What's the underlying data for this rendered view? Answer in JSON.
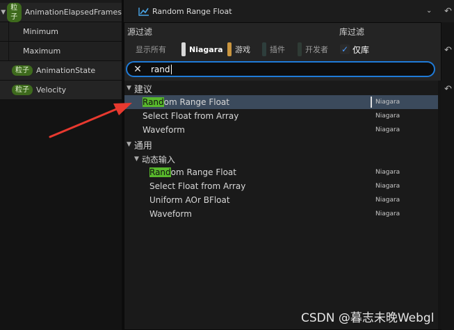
{
  "params": {
    "rows": [
      {
        "badge": "粒子",
        "name": "AnimationElapsedFrames",
        "expanded": true
      },
      {
        "name": "Minimum"
      },
      {
        "name": "Maximum"
      },
      {
        "badge": "粒子",
        "name": "AnimationState"
      },
      {
        "badge": "粒子",
        "name": "Velocity"
      }
    ]
  },
  "header": {
    "selected_value": "Random Range Float",
    "value_icon": "chart-line-icon",
    "dropdown_icon": "chevron-down-icon",
    "reset_icon": "reset-arrow-icon"
  },
  "popup": {
    "source_filter_label": "源过滤",
    "library_filter_label": "库过滤",
    "source_chips": [
      {
        "label": "显示所有",
        "active": false
      },
      {
        "label": "Niagara",
        "active": true,
        "color": "#d8d8d8"
      },
      {
        "label": "游戏",
        "active": false,
        "color": "#c9953f"
      },
      {
        "label": "插件",
        "active": false,
        "color": "#2e3e3c"
      },
      {
        "label": "开发者",
        "active": false,
        "color": "#2f3b35"
      }
    ],
    "library_only": {
      "label": "仅库",
      "checked": true
    },
    "search": {
      "value": "rand",
      "clear_icon": "close-icon"
    },
    "groups": [
      {
        "label": "建议",
        "items": [
          {
            "match": "Rand",
            "rest": "om Range Float",
            "source": "Niagara",
            "selected": true
          },
          {
            "match": "",
            "rest": "Select Float from Array",
            "source": "Niagara"
          },
          {
            "match": "",
            "rest": "Waveform",
            "source": "Niagara"
          }
        ]
      },
      {
        "label": "通用",
        "subgroup": "动态输入",
        "items": [
          {
            "match": "Rand",
            "rest": "om Range Float",
            "source": "Niagara"
          },
          {
            "match": "",
            "rest": "Select Float from Array",
            "source": "Niagara"
          },
          {
            "match": "",
            "rest": "Uniform AOr BFloat",
            "source": "Niagara"
          },
          {
            "match": "",
            "rest": "Waveform",
            "source": "Niagara"
          }
        ]
      }
    ]
  },
  "colors": {
    "accent": "#1f7bd8",
    "match_highlight": "#58b82c",
    "annotation_arrow": "#e8392f"
  },
  "watermark": "CSDN @暮志未晚Webgl"
}
